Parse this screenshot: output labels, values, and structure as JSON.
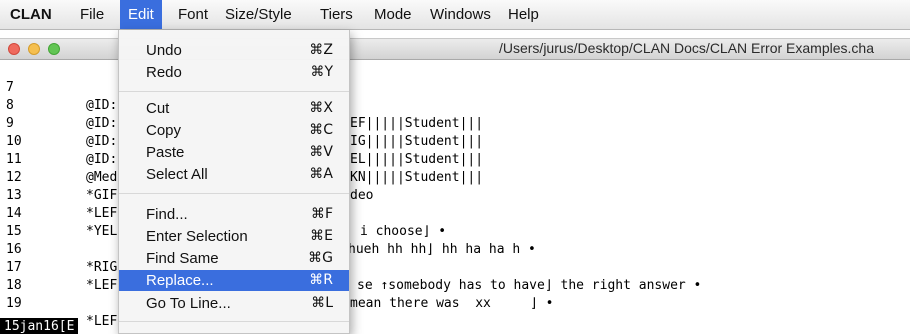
{
  "menubar": {
    "items": [
      {
        "label": "CLAN"
      },
      {
        "label": "File"
      },
      {
        "label": "Edit"
      },
      {
        "label": "Font"
      },
      {
        "label": "Size/Style"
      },
      {
        "label": "Tiers"
      },
      {
        "label": "Mode"
      },
      {
        "label": "Windows"
      },
      {
        "label": "Help"
      }
    ],
    "active": "Edit"
  },
  "window": {
    "title": "/Users/jurus/Desktop/CLAN Docs/CLAN Error Examples.cha"
  },
  "lines": [
    {
      "num": "7",
      "code": "@ID:",
      "tail": "EF|||||Student|||"
    },
    {
      "num": "8",
      "code": "@ID:",
      "tail": "IG|||||Student|||"
    },
    {
      "num": "9",
      "code": "@ID:",
      "tail": "EL|||||Student|||"
    },
    {
      "num": "10",
      "code": "@ID:",
      "tail": "KN|||||Student|||"
    },
    {
      "num": "11",
      "code": "@Med",
      "tail": "deo"
    },
    {
      "num": "12",
      "code": "*GIF",
      "tail": ""
    },
    {
      "num": "13",
      "code": "*LEF",
      "tail": "i choose⌋ •"
    },
    {
      "num": "14",
      "code": "*YEL",
      "tail": "hueh hh hh⌋ hh ha ha h •"
    },
    {
      "num": "15",
      "code": "",
      "tail": ""
    },
    {
      "num": "16",
      "code": "*RIG",
      "tail": "se ↑somebody has to have⌋ the right answer •"
    },
    {
      "num": "17",
      "code": "*LEF",
      "tail": "mean there was  xx     ⌋ •"
    },
    {
      "num": "18",
      "code": "",
      "tail": ""
    },
    {
      "num": "19",
      "code": "*LEF",
      "tail": ""
    }
  ],
  "status": "15jan16[E",
  "edit_menu": {
    "items": [
      {
        "label": "Undo",
        "shortcut": "⌘Z"
      },
      {
        "label": "Redo",
        "shortcut": "⌘Y"
      },
      {
        "label": "Cut",
        "shortcut": "⌘X"
      },
      {
        "label": "Copy",
        "shortcut": "⌘C"
      },
      {
        "label": "Paste",
        "shortcut": "⌘V"
      },
      {
        "label": "Select All",
        "shortcut": "⌘A"
      },
      {
        "label": "Find...",
        "shortcut": "⌘F"
      },
      {
        "label": "Enter Selection",
        "shortcut": "⌘E"
      },
      {
        "label": "Find Same",
        "shortcut": "⌘G"
      },
      {
        "label": "Replace...",
        "shortcut": "⌘R"
      },
      {
        "label": "Go To Line...",
        "shortcut": "⌘L"
      }
    ],
    "selected": "Replace..."
  },
  "colors": {
    "selection": "#3a6ede",
    "close": "#ef6a5e",
    "minimize": "#f5bf4f",
    "maximize": "#62c554"
  }
}
